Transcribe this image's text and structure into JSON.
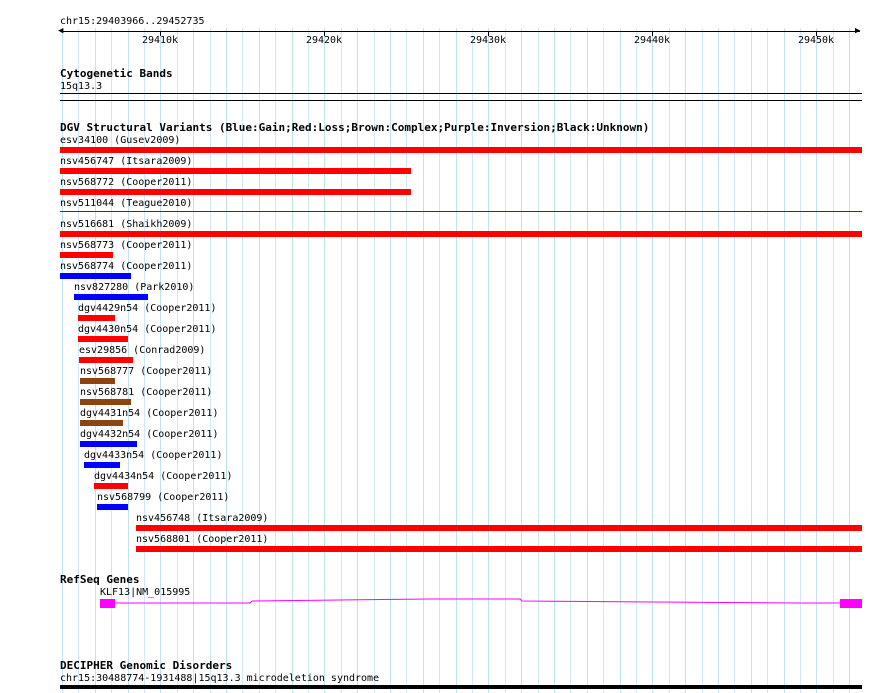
{
  "ruler": {
    "region": "chr15:29403966..29452735",
    "ticks": [
      "29410k",
      "29420k",
      "29430k",
      "29440k",
      "29450k"
    ]
  },
  "cytobands": {
    "title": "Cytogenetic Bands",
    "band": "15q13.3"
  },
  "dgv": {
    "title": "DGV Structural Variants (Blue:Gain;Red:Loss;Brown:Complex;Purple:Inversion;Black:Unknown)",
    "colors": {
      "gain": "#0000ff",
      "loss": "#ff0000",
      "complex": "#8b4513",
      "inversion": "#800080",
      "unknown": "#000000"
    },
    "variants": [
      {
        "label": "esv34100 (Gusev2009)",
        "type": "loss"
      },
      {
        "label": "nsv456747 (Itsara2009)",
        "type": "loss"
      },
      {
        "label": "nsv568772 (Cooper2011)",
        "type": "loss"
      },
      {
        "label": "nsv511044 (Teague2010)",
        "type": "inversion"
      },
      {
        "label": "nsv516681 (Shaikh2009)",
        "type": "loss"
      },
      {
        "label": "nsv568773 (Cooper2011)",
        "type": "loss"
      },
      {
        "label": "nsv568774 (Cooper2011)",
        "type": "gain"
      },
      {
        "label": "nsv827280 (Park2010)",
        "type": "gain"
      },
      {
        "label": "dgv4429n54 (Cooper2011)",
        "type": "loss"
      },
      {
        "label": "dgv4430n54 (Cooper2011)",
        "type": "loss"
      },
      {
        "label": "esv29856 (Conrad2009)",
        "type": "loss"
      },
      {
        "label": "nsv568777 (Cooper2011)",
        "type": "complex"
      },
      {
        "label": "nsv568781 (Cooper2011)",
        "type": "complex"
      },
      {
        "label": "dgv4431n54 (Cooper2011)",
        "type": "complex"
      },
      {
        "label": "dgv4432n54 (Cooper2011)",
        "type": "gain"
      },
      {
        "label": "dgv4433n54 (Cooper2011)",
        "type": "gain"
      },
      {
        "label": "dgv4434n54 (Cooper2011)",
        "type": "loss"
      },
      {
        "label": "nsv568799 (Cooper2011)",
        "type": "gain"
      },
      {
        "label": "nsv456748 (Itsara2009)",
        "type": "loss"
      },
      {
        "label": "nsv568801 (Cooper2011)",
        "type": "loss"
      }
    ]
  },
  "refseq": {
    "title": "RefSeq Genes",
    "gene": "KLF13|NM_015995",
    "color": "#ff00ff"
  },
  "decipher": {
    "title": "DECIPHER Genomic Disorders",
    "label": "chr15:30488774-1931488|15q13.3 microdeletion syndrome"
  }
}
